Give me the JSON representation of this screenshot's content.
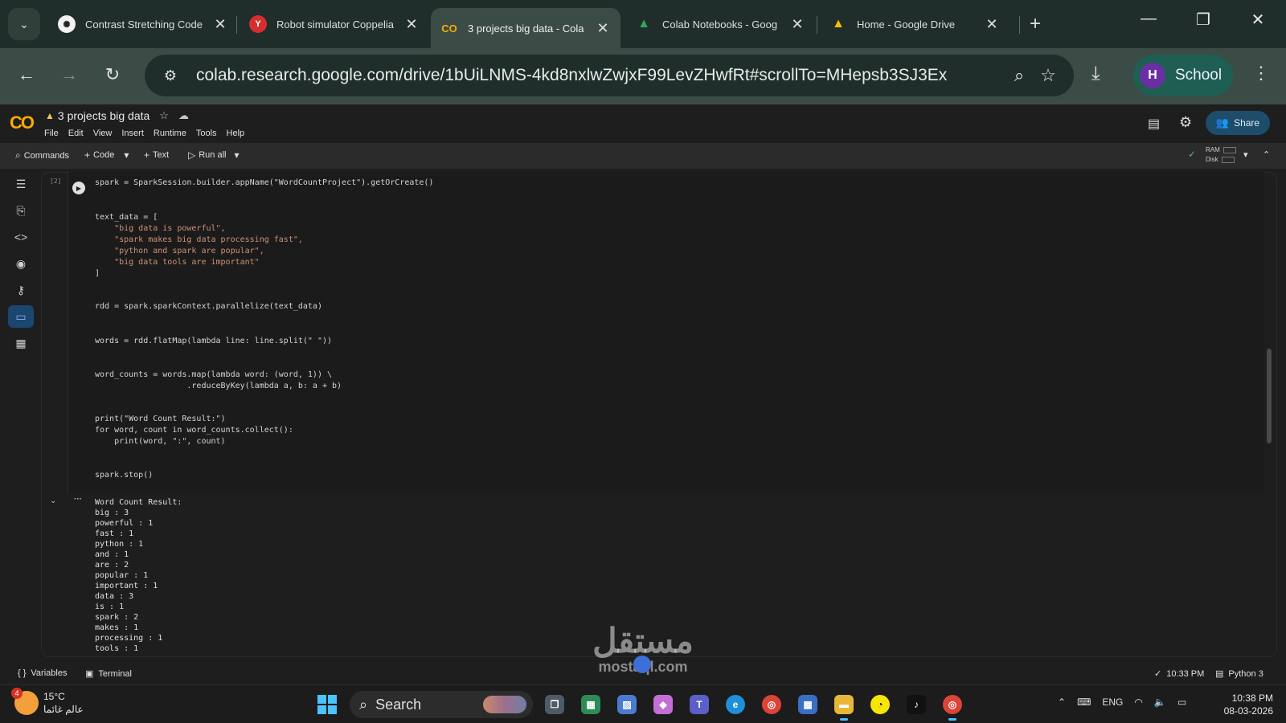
{
  "browser": {
    "tabs": [
      {
        "title": "Contrast Stretching Code",
        "icon": "chatgpt-icon",
        "active": false
      },
      {
        "title": "Robot simulator Coppelia",
        "icon": "coppelia-icon",
        "active": false
      },
      {
        "title": "3 projects big data - Cola",
        "icon": "colab-icon",
        "active": true
      },
      {
        "title": "Colab Notebooks - Goog",
        "icon": "drive-icon",
        "active": false
      },
      {
        "title": "Home - Google Drive",
        "icon": "drive-icon",
        "active": false
      }
    ],
    "url": "colab.research.google.com/drive/1bUiLNMS-4kd8nxlwZwjxF99LevZHwfRt#scrollTo=MHepsb3SJ3Ex",
    "profile": {
      "initial": "H",
      "name": "School"
    }
  },
  "colab": {
    "logo": "CO",
    "notebook_title": "3 projects big data",
    "menu": [
      "File",
      "Edit",
      "View",
      "Insert",
      "Runtime",
      "Tools",
      "Help"
    ],
    "share_label": "Share",
    "toolbar": {
      "commands": "Commands",
      "code": "Code",
      "text": "Text",
      "run_all": "Run all",
      "ram": "RAM",
      "disk": "Disk"
    },
    "cell": {
      "exec_count": "[2]",
      "code_lines": [
        "spark = SparkSession.builder.appName(\"WordCountProject\").getOrCreate()",
        "text_data = [",
        "    \"big data is powerful\",",
        "    \"spark makes big data processing fast\",",
        "    \"python and spark are popular\",",
        "    \"big data tools are important\"",
        "]",
        "rdd = spark.sparkContext.parallelize(text_data)",
        "words = rdd.flatMap(lambda line: line.split(\" \"))",
        "word_counts = words.map(lambda word: (word, 1)) \\",
        "                   .reduceByKey(lambda a, b: a + b)",
        "print(\"Word Count Result:\")",
        "for word, count in word_counts.collect():",
        "    print(word, \":\", count)",
        "spark.stop()"
      ],
      "output_lines": [
        "Word Count Result:",
        "big : 3",
        "powerful : 1",
        "fast : 1",
        "python : 1",
        "and : 1",
        "are : 2",
        "popular : 1",
        "important : 1",
        "data : 3",
        "is : 1",
        "spark : 2",
        "makes : 1",
        "processing : 1",
        "tools : 1"
      ]
    },
    "statusbar": {
      "variables": "Variables",
      "terminal": "Terminal",
      "last_run": "10:33 PM",
      "runtime": "Python 3"
    }
  },
  "watermark": {
    "arabic": "مستقل",
    "latin": "mostaql.com"
  },
  "taskbar": {
    "weather_badge": "4",
    "temperature": "15°C",
    "weather_caption": "عالم غائما",
    "search_label": "Search",
    "language": "ENG",
    "time": "10:38 PM",
    "date": "08-03-2026"
  },
  "colors": {
    "accent": "#8ab4f8",
    "colab_orange": "#f9ab00",
    "share_bg": "#1d4d6b",
    "profile_chip": "#1f5e53"
  }
}
